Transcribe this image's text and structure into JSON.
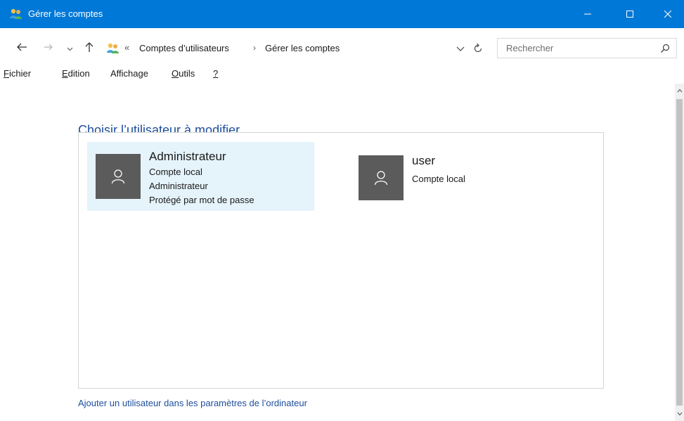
{
  "window": {
    "title": "Gérer les comptes",
    "accent_color": "#0078d7",
    "app_icon": "users-icon",
    "controls": [
      "minimize-icon",
      "maximize-icon",
      "close-icon"
    ]
  },
  "address_bar": {
    "overflow_marker": "«",
    "location_icon": "users-icon",
    "breadcrumbs": [
      {
        "label": "Comptes d’utilisateurs"
      },
      {
        "label": "Gérer les comptes"
      }
    ],
    "separator": "›",
    "search_placeholder": "Rechercher"
  },
  "menu": {
    "items": [
      {
        "accel": "F",
        "rest": "ichier"
      },
      {
        "accel": "E",
        "rest": "dition"
      },
      {
        "pre": "Afficha",
        "accel": "g",
        "rest": "e"
      },
      {
        "accel": "O",
        "rest": "utils"
      },
      {
        "accel": "?",
        "rest": ""
      }
    ]
  },
  "main": {
    "heading": "Choisir l’utilisateur à modifier",
    "accounts": [
      {
        "name": "Administrateur",
        "details": [
          "Compte local",
          "Administrateur",
          "Protégé par mot de passe"
        ],
        "selected": true,
        "avatar_icon": "user-avatar-icon"
      },
      {
        "name": "user",
        "details": [
          "Compte local"
        ],
        "selected": false,
        "avatar_icon": "user-avatar-icon"
      }
    ],
    "add_user_link": "Ajouter un utilisateur dans les paramètres de l’ordinateur"
  },
  "colors": {
    "link": "#1e4e9c",
    "selected_bg": "#e5f3fb",
    "avatar_bg": "#5b5b5b"
  }
}
